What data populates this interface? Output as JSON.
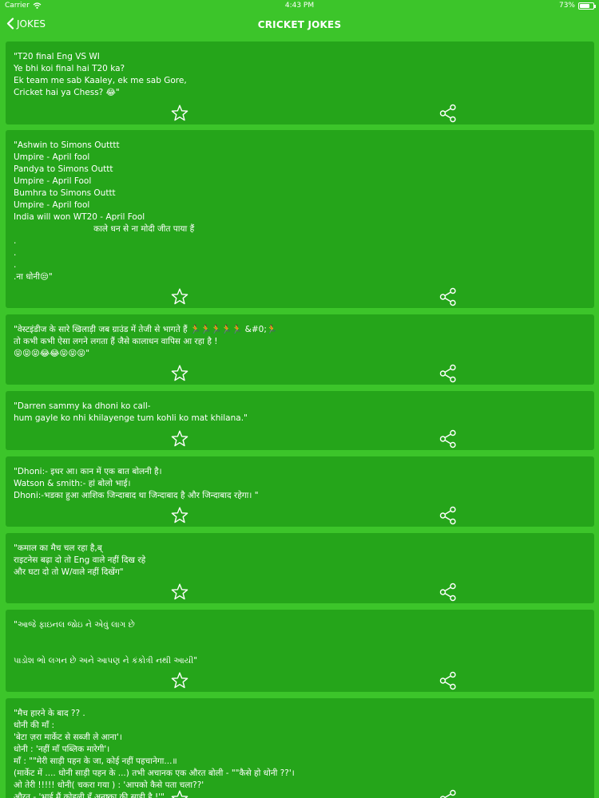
{
  "status_bar": {
    "carrier": "Carrier",
    "time": "4:43 PM",
    "battery": "73%",
    "battery_level": 0.73
  },
  "nav": {
    "back_label": "JOKES",
    "title": "CRICKET JOKES"
  },
  "icons": {
    "back": "chevron-left-icon",
    "favorite": "star-outline-icon",
    "share": "share-icon",
    "wifi": "wifi-icon",
    "battery": "battery-icon"
  },
  "jokes": [
    {
      "text": "\"T20 final Eng VS WI\nYe bhi koi final hai T20 ka?\nEk team me sab Kaaley, ek me sab Gore,\nCricket hai ya Chess? 😂\""
    },
    {
      "text": "\"Ashwin to Simons Outttt\nUmpire - April fool\nPandya to Simons Outtt\nUmpire - April Fool\nBumhra to Simons Outtt\nUmpire - April fool\nIndia will won WT20 - April Fool\n                              काले धन से ना मोदी जीत पाया हैं\n.\n.\n.\n.ना धोनी😒\""
    },
    {
      "text": "\"वेस्टइंडीज के सारे खिलाड़ी जब ग्राउंड में तेजी से भागते हैं 🏃🏃🏃🏃🏃 &#0;🏃\nतो कभी कभी ऐसा लगने लगता हैं जैसे कालाधन वापिस आ रहा है !\n😝😝😝😂😂😝😝😝\""
    },
    {
      "text": "\"Darren sammy ka dhoni ko call-\nhum gayle ko nhi khilayenge tum kohli ko mat khilana.\""
    },
    {
      "text": "\"Dhoni:- इधर आ। कान में एक बात बोलनी है।\nWatson & smith:- हां बोलो भाई।\nDhoni:-भडका हुआ आशिक जिन्दाबाद था जिन्दाबाद है और जिन्दाबाद रहेगा। \""
    },
    {
      "text": "\"कमाल का मैच चल रहा है,ब्\nराइटनेस बढ़ा दो तो Eng वाले नहीं दिख रहे\nऔर घटा दो तो W/वाले नहीं दिखेंग\""
    },
    {
      "text": "\"આજે ફાઇનલ જોઇ ને એવું લાગ છે\n\n\nપાડોશ ભો લગન છે અને આપણ ને કંકોત્રી નથી આયી\""
    },
    {
      "text": "\"मैच हारने के बाद ?? .\nधोनी की माँ :\n'बेटा ज़रा मार्केट से सब्जी ले आना'।\nधोनी : 'नहीं माँ पब्लिक मारेगी'।\nमाँ : \"\"मेरी साड़ी पहन के जा, कोई नहीं पहचानेगा...॥\n(मार्केट में .... धोनी साड़ी पहन के ...) तभी अचानक एक औरत बोली - \"\"कैसे हो धोनी ??'।\nओ तेरी !!!!! धोनी( चकरा गया ) : 'आपको कैसे पता चला??'\nऔरत - 'भाई मैं कोहली हूँ अनुष्का की साड़ी है !'\""
    }
  ]
}
